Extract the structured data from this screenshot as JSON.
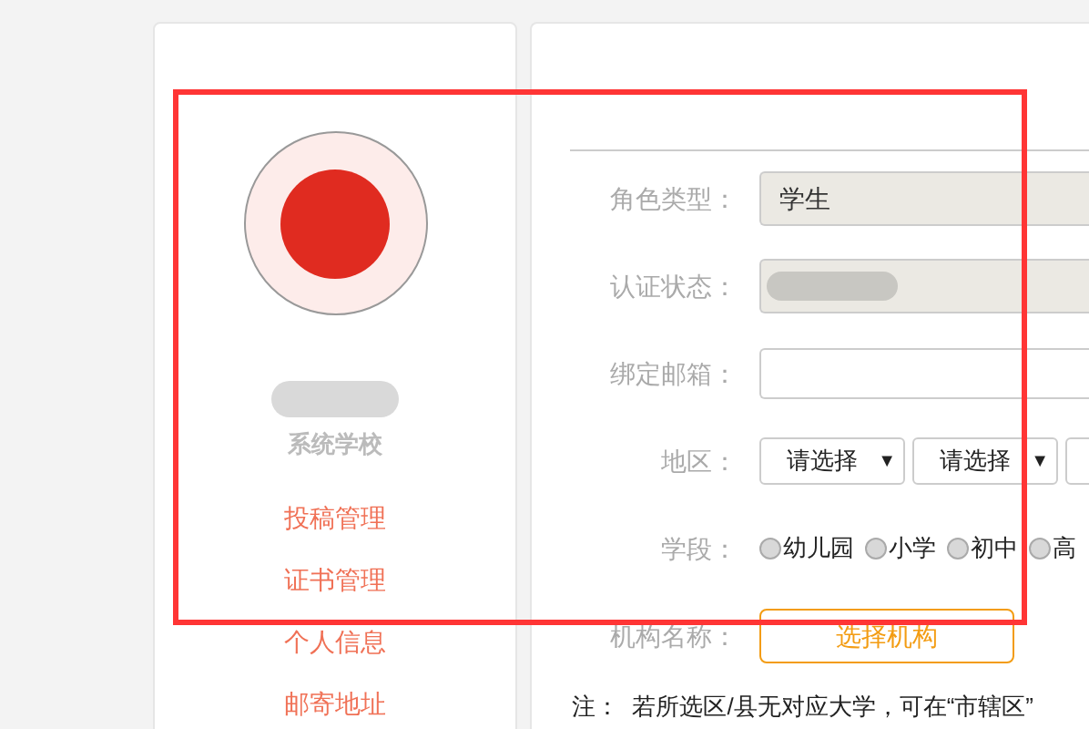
{
  "sidebar": {
    "school": "系统学校",
    "menu": [
      {
        "label": "投稿管理"
      },
      {
        "label": "证书管理"
      },
      {
        "label": "个人信息"
      },
      {
        "label": "邮寄地址"
      }
    ]
  },
  "form": {
    "rows": [
      {
        "kind": "readonly",
        "label": "角色类型：",
        "value": "学生"
      },
      {
        "kind": "blurred",
        "label": "认证状态："
      },
      {
        "kind": "input",
        "label": "绑定邮箱："
      },
      {
        "kind": "selects",
        "label": "地区：",
        "selects": [
          {
            "label": "请选择",
            "caret": "▼"
          },
          {
            "label": "请选择",
            "caret": "▼"
          }
        ]
      },
      {
        "kind": "radios",
        "label": "学段：",
        "options": [
          {
            "label": "幼儿园",
            "selected": false
          },
          {
            "label": "小学",
            "selected": false
          },
          {
            "label": "初中",
            "selected": false
          },
          {
            "label": "高",
            "selected": false
          }
        ]
      },
      {
        "kind": "button",
        "label": "机构名称：",
        "button": "选择机构"
      }
    ],
    "note": "注：  若所选区/县无对应大学，可在“市辖区”"
  },
  "highlight": {
    "shown": true
  }
}
